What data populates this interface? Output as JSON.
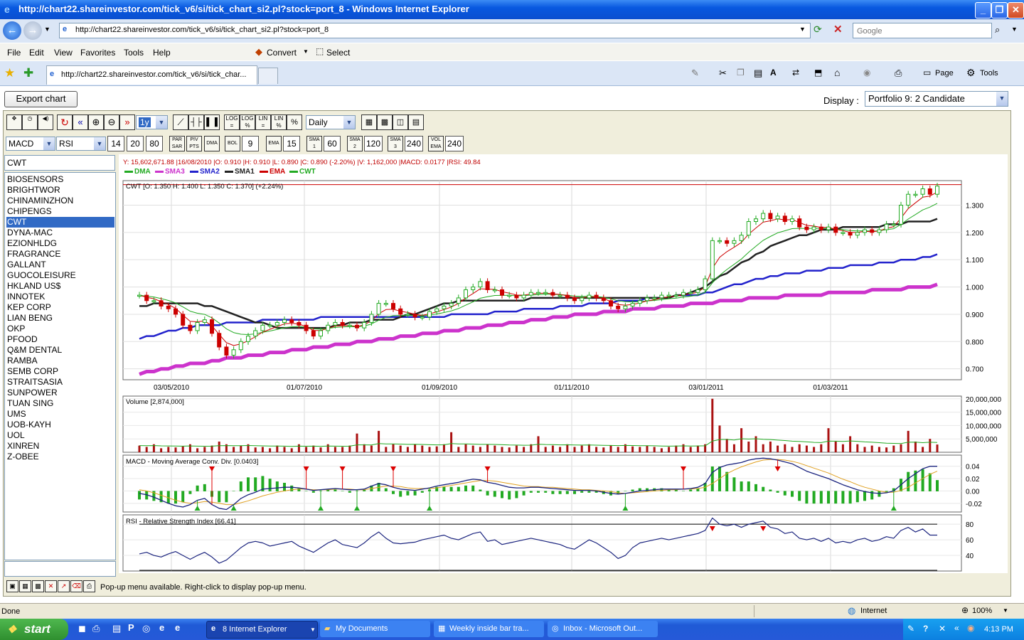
{
  "window": {
    "title": "http://chart22.shareinvestor.com/tick_v6/si/tick_chart_si2.pl?stock=port_8 - Windows Internet Explorer",
    "address": "http://chart22.shareinvestor.com/tick_v6/si/tick_chart_si2.pl?stock=port_8",
    "search_placeholder": "Google"
  },
  "menu": [
    "File",
    "Edit",
    "View",
    "Favorites",
    "Tools",
    "Help"
  ],
  "toolbar": {
    "convert": "Convert",
    "select": "Select",
    "page": "Page",
    "tools": "Tools"
  },
  "tab": {
    "title": "http://chart22.shareinvestor.com/tick_v6/si/tick_char..."
  },
  "page": {
    "export_label": "Export chart",
    "display_label": "Display :",
    "display_value": "Portfolio 9: 2 Candidate",
    "period_value": "1y",
    "interval_value": "Daily",
    "indicator1": "MACD",
    "indicator2": "RSI",
    "params": [
      "14",
      "20",
      "80"
    ],
    "bol_value": "9",
    "ema_value": "15",
    "sma1_value": "60",
    "sma2_value": "120",
    "sma3_value": "240",
    "volema_value": "240",
    "stock_input": "CWT",
    "stocks": [
      "BIOSENSORS",
      "BRIGHTWOR",
      "CHINAMINZHON",
      "CHIPENGS",
      "CWT",
      "DYNA-MAC",
      "EZIONHLDG",
      "FRAGRANCE",
      "GALLANT",
      "GUOCOLEISURE",
      "HKLAND US$",
      "INNOTEK",
      "KEP CORP",
      "LIAN BENG",
      "OKP",
      "PFOOD",
      "Q&M DENTAL",
      "RAMBA",
      "SEMB CORP",
      "STRAITSASIA",
      "SUNPOWER",
      "TUAN SING",
      "UMS",
      "UOB-KAYH",
      "UOL",
      "XINREN",
      "Z-OBEE"
    ],
    "selected_stock": "CWT",
    "popup_msg": "Pop-up menu available. Right-click to display pop-up menu."
  },
  "chart_data": [
    {
      "type": "candlestick",
      "info_line": "Y: 15,602,671.88 |16/08/2010 |O: 0.910 |H: 0.910 |L: 0.890 |C: 0.890 (-2.20%) |V: 1,162,000 |MACD: 0.0177 |RSI: 49.84",
      "legend": [
        "DMA",
        "SMA3",
        "SMA2",
        "SMA1",
        "EMA",
        "CWT"
      ],
      "legend_colors": [
        "#22aa22",
        "#cc33cc",
        "#2222cc",
        "#222222",
        "#cc0000",
        "#22aa22"
      ],
      "title": "CWT [O: 1.350  H: 1.400  L: 1.350  C: 1.370] (+2.24%)",
      "x_ticks": [
        "03/05/2010",
        "01/07/2010",
        "01/09/2010",
        "01/11/2010",
        "03/01/2011",
        "01/03/2011"
      ],
      "y_ticks": [
        "1.300",
        "1.200",
        "1.100",
        "1.000",
        "0.900",
        "0.800",
        "0.700"
      ],
      "ylim": [
        0.66,
        1.39
      ],
      "close": [
        0.97,
        0.95,
        0.95,
        0.93,
        0.92,
        0.9,
        0.86,
        0.84,
        0.87,
        0.88,
        0.83,
        0.78,
        0.75,
        0.77,
        0.8,
        0.82,
        0.84,
        0.86,
        0.86,
        0.87,
        0.88,
        0.87,
        0.86,
        0.84,
        0.82,
        0.84,
        0.86,
        0.87,
        0.86,
        0.86,
        0.85,
        0.87,
        0.9,
        0.94,
        0.94,
        0.92,
        0.9,
        0.9,
        0.89,
        0.89,
        0.91,
        0.92,
        0.93,
        0.94,
        0.96,
        0.99,
        1.0,
        1.02,
        0.99,
        0.99,
        0.97,
        0.97,
        0.96,
        0.97,
        0.98,
        0.98,
        0.98,
        0.97,
        0.97,
        0.96,
        0.95,
        0.96,
        0.97,
        0.96,
        0.95,
        0.93,
        0.92,
        0.93,
        0.94,
        0.95,
        0.96,
        0.96,
        0.97,
        0.97,
        0.97,
        0.98,
        0.98,
        0.99,
        1.03,
        1.17,
        1.17,
        1.16,
        1.17,
        1.19,
        1.24,
        1.25,
        1.27,
        1.25,
        1.26,
        1.24,
        1.25,
        1.22,
        1.21,
        1.22,
        1.21,
        1.22,
        1.2,
        1.2,
        1.19,
        1.2,
        1.21,
        1.2,
        1.21,
        1.23,
        1.23,
        1.3,
        1.34,
        1.34,
        1.36,
        1.34,
        1.37
      ],
      "sma1": [
        0.93,
        0.93,
        0.94,
        0.94,
        0.94,
        0.94,
        0.94,
        0.94,
        0.94,
        0.93,
        0.93,
        0.92,
        0.91,
        0.9,
        0.89,
        0.88,
        0.87,
        0.87,
        0.86,
        0.85,
        0.85,
        0.85,
        0.85,
        0.85,
        0.85,
        0.85,
        0.85,
        0.86,
        0.86,
        0.87,
        0.87,
        0.87,
        0.88,
        0.88,
        0.88,
        0.88,
        0.89,
        0.9,
        0.9,
        0.91,
        0.92,
        0.93,
        0.94,
        0.94,
        0.95,
        0.95,
        0.95,
        0.95,
        0.95,
        0.95,
        0.95,
        0.95,
        0.95,
        0.95,
        0.96,
        0.96,
        0.96,
        0.96,
        0.96,
        0.96,
        0.96,
        0.96,
        0.96,
        0.96,
        0.96,
        0.96,
        0.96,
        0.96,
        0.96,
        0.96,
        0.96,
        0.96,
        0.96,
        0.96,
        0.97,
        0.97,
        0.98,
        0.99,
        1.0,
        1.02,
        1.04,
        1.05,
        1.07,
        1.09,
        1.1,
        1.12,
        1.13,
        1.15,
        1.16,
        1.17,
        1.18,
        1.19,
        1.19,
        1.2,
        1.21,
        1.21,
        1.21,
        1.22,
        1.22,
        1.22,
        1.22,
        1.22,
        1.22,
        1.23,
        1.23,
        1.23,
        1.24,
        1.24,
        1.24,
        1.24,
        1.25
      ],
      "sma2": [
        0.81,
        0.82,
        0.82,
        0.83,
        0.84,
        0.84,
        0.85,
        0.85,
        0.86,
        0.86,
        0.86,
        0.86,
        0.87,
        0.87,
        0.87,
        0.87,
        0.87,
        0.88,
        0.88,
        0.88,
        0.88,
        0.88,
        0.88,
        0.88,
        0.88,
        0.89,
        0.89,
        0.89,
        0.89,
        0.89,
        0.89,
        0.89,
        0.89,
        0.89,
        0.89,
        0.89,
        0.89,
        0.89,
        0.89,
        0.89,
        0.89,
        0.89,
        0.89,
        0.9,
        0.9,
        0.9,
        0.9,
        0.9,
        0.9,
        0.91,
        0.91,
        0.91,
        0.91,
        0.92,
        0.92,
        0.92,
        0.92,
        0.92,
        0.93,
        0.93,
        0.93,
        0.93,
        0.94,
        0.94,
        0.94,
        0.94,
        0.95,
        0.95,
        0.95,
        0.95,
        0.96,
        0.96,
        0.96,
        0.96,
        0.97,
        0.97,
        0.97,
        0.97,
        0.98,
        0.98,
        0.99,
        1.0,
        1.01,
        1.01,
        1.02,
        1.03,
        1.03,
        1.04,
        1.04,
        1.05,
        1.05,
        1.05,
        1.06,
        1.06,
        1.06,
        1.07,
        1.07,
        1.07,
        1.08,
        1.08,
        1.08,
        1.08,
        1.09,
        1.09,
        1.09,
        1.1,
        1.1,
        1.1,
        1.11,
        1.11,
        1.12
      ],
      "sma3": [
        0.68,
        0.69,
        0.69,
        0.7,
        0.7,
        0.71,
        0.71,
        0.72,
        0.72,
        0.72,
        0.73,
        0.73,
        0.74,
        0.74,
        0.74,
        0.75,
        0.75,
        0.75,
        0.76,
        0.76,
        0.76,
        0.77,
        0.77,
        0.77,
        0.78,
        0.78,
        0.78,
        0.79,
        0.79,
        0.79,
        0.8,
        0.8,
        0.8,
        0.81,
        0.81,
        0.81,
        0.82,
        0.82,
        0.82,
        0.83,
        0.83,
        0.83,
        0.84,
        0.84,
        0.84,
        0.85,
        0.85,
        0.85,
        0.86,
        0.86,
        0.86,
        0.87,
        0.87,
        0.87,
        0.88,
        0.88,
        0.88,
        0.89,
        0.89,
        0.89,
        0.9,
        0.9,
        0.9,
        0.9,
        0.91,
        0.91,
        0.91,
        0.91,
        0.92,
        0.92,
        0.92,
        0.92,
        0.93,
        0.93,
        0.93,
        0.93,
        0.94,
        0.94,
        0.94,
        0.94,
        0.95,
        0.95,
        0.95,
        0.95,
        0.96,
        0.96,
        0.96,
        0.96,
        0.96,
        0.97,
        0.97,
        0.97,
        0.97,
        0.97,
        0.97,
        0.98,
        0.98,
        0.98,
        0.98,
        0.98,
        0.98,
        0.99,
        0.99,
        0.99,
        0.99,
        0.99,
        1.0,
        1.0,
        1.0,
        1.0,
        1.01
      ]
    },
    {
      "type": "bar",
      "title": "Volume [2,874,000]",
      "y_ticks": [
        "20,000,000",
        "15,000,000",
        "10,000,000",
        "5,000,000"
      ],
      "ylim": [
        0,
        21000000
      ],
      "values": [
        2.5,
        2,
        3,
        1.5,
        2,
        1.8,
        2.2,
        3,
        1.5,
        2,
        2.5,
        4,
        3,
        2,
        2.5,
        3,
        1.8,
        2,
        1.5,
        2.5,
        2,
        1.5,
        3,
        2,
        2.5,
        1.8,
        3,
        2,
        2,
        2.5,
        7,
        3,
        2.5,
        8,
        2,
        3,
        2.5,
        2,
        3,
        2.5,
        2,
        2.2,
        3,
        7.5,
        2,
        3,
        2.5,
        2,
        3,
        2.5,
        2,
        1.8,
        2.5,
        2,
        3,
        6,
        2,
        2.5,
        2,
        3,
        2,
        2.5,
        3,
        2,
        1.8,
        2.5,
        2,
        3,
        2.2,
        2,
        2.5,
        2,
        1.5,
        2,
        2.5,
        3,
        2,
        2.5,
        3,
        20,
        10,
        5,
        3,
        9,
        4,
        6,
        3,
        4,
        2.5,
        3,
        2,
        3,
        2.5,
        2,
        3,
        9,
        4,
        3,
        6,
        3,
        2,
        2.5,
        2,
        1.8,
        2.5,
        3,
        8,
        4,
        2,
        5,
        2.9
      ]
    },
    {
      "type": "line",
      "title": "MACD - Moving Average Conv. Div. [0.0403]",
      "y_ticks": [
        "0.04",
        "0.02",
        "0.00",
        "-0.02"
      ],
      "ylim": [
        -0.034,
        0.058
      ],
      "macd": [
        -0.004,
        -0.006,
        -0.01,
        -0.015,
        -0.02,
        -0.024,
        -0.026,
        -0.022,
        -0.015,
        -0.012,
        -0.022,
        -0.028,
        -0.03,
        -0.022,
        -0.012,
        -0.006,
        -0.002,
        0.003,
        0.004,
        0.005,
        0.006,
        0.006,
        0.005,
        0.003,
        0.001,
        0.002,
        0.003,
        0.004,
        0.003,
        0.002,
        0.002,
        0.003,
        0.008,
        0.012,
        0.01,
        0.006,
        0.003,
        0.002,
        0.001,
        0.003,
        0.005,
        0.008,
        0.01,
        0.012,
        0.014,
        0.017,
        0.019,
        0.018,
        0.014,
        0.012,
        0.009,
        0.006,
        0.005,
        0.005,
        0.006,
        0.006,
        0.005,
        0.004,
        0.003,
        0.002,
        0.001,
        0.001,
        0.001,
        0.0,
        -0.002,
        -0.004,
        -0.005,
        -0.004,
        -0.002,
        0.0,
        0.001,
        0.002,
        0.003,
        0.003,
        0.003,
        0.003,
        0.004,
        0.006,
        0.012,
        0.03,
        0.038,
        0.042,
        0.044,
        0.046,
        0.05,
        0.052,
        0.053,
        0.052,
        0.05,
        0.047,
        0.044,
        0.038,
        0.032,
        0.028,
        0.024,
        0.02,
        0.015,
        0.01,
        0.006,
        0.002,
        -0.001,
        -0.003,
        -0.004,
        -0.003,
        0.0,
        0.01,
        0.02,
        0.028,
        0.036,
        0.04,
        0.04
      ],
      "signal": [
        0.002,
        0.0,
        -0.003,
        -0.007,
        -0.011,
        -0.015,
        -0.018,
        -0.02,
        -0.019,
        -0.017,
        -0.018,
        -0.02,
        -0.022,
        -0.022,
        -0.019,
        -0.016,
        -0.012,
        -0.008,
        -0.005,
        -0.002,
        0.0,
        0.002,
        0.003,
        0.003,
        0.002,
        0.002,
        0.002,
        0.003,
        0.003,
        0.003,
        0.002,
        0.002,
        0.004,
        0.006,
        0.008,
        0.008,
        0.007,
        0.005,
        0.004,
        0.004,
        0.004,
        0.005,
        0.007,
        0.009,
        0.011,
        0.013,
        0.015,
        0.017,
        0.017,
        0.016,
        0.014,
        0.012,
        0.01,
        0.008,
        0.007,
        0.007,
        0.006,
        0.006,
        0.005,
        0.004,
        0.003,
        0.002,
        0.002,
        0.001,
        0.0,
        -0.001,
        -0.003,
        -0.004,
        -0.003,
        -0.002,
        -0.001,
        0.0,
        0.001,
        0.002,
        0.002,
        0.003,
        0.003,
        0.004,
        0.006,
        0.012,
        0.02,
        0.028,
        0.034,
        0.039,
        0.043,
        0.047,
        0.05,
        0.051,
        0.051,
        0.05,
        0.048,
        0.045,
        0.041,
        0.037,
        0.033,
        0.029,
        0.024,
        0.019,
        0.015,
        0.01,
        0.006,
        0.003,
        0.0,
        -0.002,
        -0.002,
        0.001,
        0.006,
        0.013,
        0.02,
        0.027,
        0.032
      ]
    },
    {
      "type": "line",
      "title": "RSI - Relative Strength Index [66.41]",
      "y_ticks": [
        "80",
        "60",
        "40"
      ],
      "ylim": [
        20,
        92
      ],
      "values": [
        42,
        44,
        40,
        38,
        42,
        45,
        40,
        35,
        40,
        44,
        38,
        30,
        34,
        42,
        50,
        56,
        58,
        56,
        52,
        54,
        56,
        58,
        52,
        48,
        44,
        50,
        56,
        60,
        54,
        52,
        50,
        56,
        64,
        70,
        62,
        56,
        55,
        56,
        57,
        60,
        62,
        64,
        66,
        62,
        60,
        64,
        68,
        70,
        58,
        60,
        54,
        56,
        58,
        60,
        62,
        60,
        58,
        56,
        54,
        50,
        48,
        54,
        60,
        56,
        50,
        44,
        36,
        40,
        50,
        56,
        58,
        60,
        62,
        60,
        62,
        64,
        66,
        68,
        72,
        88,
        80,
        78,
        80,
        76,
        80,
        82,
        84,
        76,
        74,
        68,
        70,
        62,
        60,
        62,
        58,
        62,
        56,
        58,
        56,
        60,
        62,
        58,
        60,
        64,
        62,
        72,
        76,
        70,
        74,
        66,
        66
      ]
    }
  ],
  "status": {
    "text": "Done",
    "zone": "Internet",
    "zoom": "100%"
  },
  "taskbar": {
    "start": "start",
    "tasks": [
      "8 Internet Explorer",
      "My Documents",
      "Weekly inside bar tra...",
      "Inbox - Microsoft Out..."
    ],
    "clock": "4:13 PM"
  },
  "colors": {
    "candle_up": "#22aa22",
    "candle_down": "#cc0000",
    "volume": "#aa1111",
    "rsi": "#1a237e",
    "macd": "#1a237e",
    "signal": "#e0a020",
    "arrow_sell": "#dd0000",
    "arrow_buy": "#22aa22"
  }
}
